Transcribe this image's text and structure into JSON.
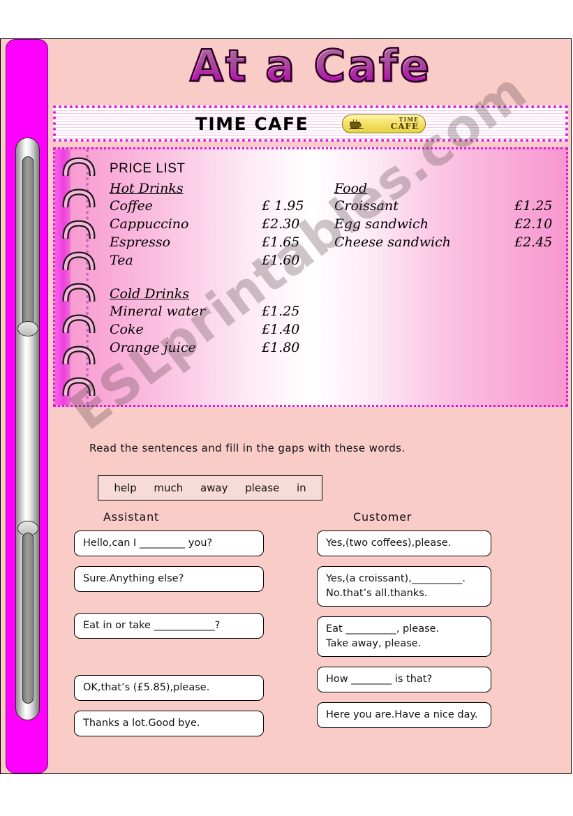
{
  "title": "At a Cafe",
  "cafe_banner": {
    "name": "TIME CAFE",
    "logo_line1": "TIME",
    "logo_line2": "CAFE"
  },
  "menu": {
    "price_list_title": "PRICE LIST",
    "sections": [
      {
        "heading": "Hot Drinks",
        "items": [
          {
            "name": "Coffee",
            "price": "£ 1.95"
          },
          {
            "name": "Cappuccino",
            "price": "£2.30"
          },
          {
            "name": "Espresso",
            "price": "£1.65"
          },
          {
            "name": "Tea",
            "price": "£1.60"
          }
        ]
      },
      {
        "heading": "Cold Drinks",
        "items": [
          {
            "name": "Mineral water",
            "price": "£1.25"
          },
          {
            "name": "Coke",
            "price": "£1.40"
          },
          {
            "name": "Orange juice",
            "price": "£1.80"
          }
        ]
      },
      {
        "heading": "Food",
        "items": [
          {
            "name": "Croissant",
            "price": "£1.25"
          },
          {
            "name": "Egg sandwich",
            "price": "£2.10"
          },
          {
            "name": "Cheese sandwich",
            "price": "£2.45"
          }
        ]
      }
    ]
  },
  "instruction": "Read the sentences and fill in the gaps with these words.",
  "word_bank": [
    "help",
    "much",
    "away",
    "please",
    "in"
  ],
  "dialogue": {
    "assistant_label": "Assistant",
    "customer_label": "Customer",
    "assistant": [
      {
        "line1": "Hello,can I _________ you?"
      },
      {
        "line1": "Sure.Anything else?"
      },
      {
        "line1": "Eat in or take ____________?"
      },
      {
        "line1": "OK,that’s (£5.85),please."
      },
      {
        "line1": "Thanks a lot.Good bye."
      }
    ],
    "customer": [
      {
        "line1": "Yes,(two coffees),please."
      },
      {
        "line1": "Yes,(a croissant),__________.",
        "line2": "No.that’s all.thanks."
      },
      {
        "line1": "Eat __________, please.",
        "line2": "Take away, please."
      },
      {
        "line1": "How ________ is that?"
      },
      {
        "line1": "Here you are.Have a nice day."
      }
    ]
  },
  "watermark": "ESLprintables.com",
  "colors": {
    "page_background": "#f9ccc8",
    "binder_magenta": "#ff00ff",
    "accent_magenta": "#e31ae3",
    "logo_yellow": "#f4e26a",
    "box_white": "#ffffff"
  }
}
